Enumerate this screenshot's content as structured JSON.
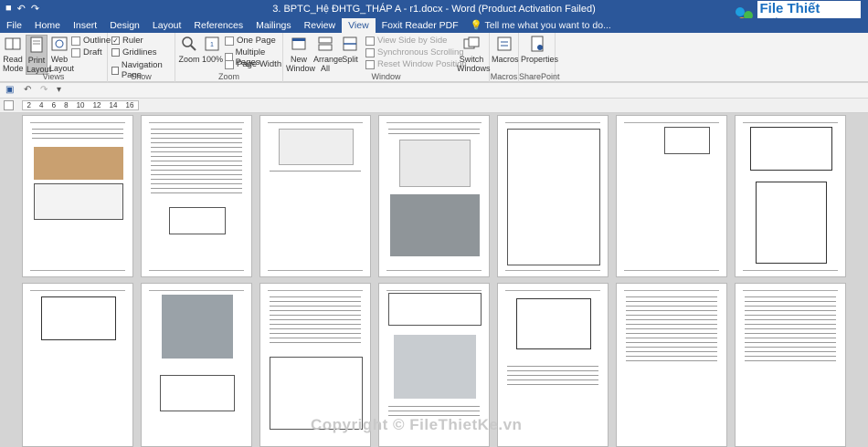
{
  "window": {
    "title": "3. BPTC_Hệ ĐHTG_THÁP A - r1.docx - Word (Product Activation Failed)"
  },
  "tabs": [
    {
      "label": "File"
    },
    {
      "label": "Home"
    },
    {
      "label": "Insert"
    },
    {
      "label": "Design"
    },
    {
      "label": "Layout"
    },
    {
      "label": "References"
    },
    {
      "label": "Mailings"
    },
    {
      "label": "Review"
    },
    {
      "label": "View"
    },
    {
      "label": "Foxit Reader PDF"
    }
  ],
  "tellme": "Tell me what you want to do...",
  "ribbon": {
    "views": {
      "label": "Views",
      "read_mode": "Read Mode",
      "print_layout": "Print Layout",
      "web_layout": "Web Layout",
      "outline": "Outline",
      "draft": "Draft"
    },
    "show": {
      "label": "Show",
      "ruler": "Ruler",
      "gridlines": "Gridlines",
      "navigation_pane": "Navigation Pane"
    },
    "zoom": {
      "label": "Zoom",
      "zoom": "Zoom",
      "hundred": "100%",
      "one_page": "One Page",
      "multiple_pages": "Multiple Pages",
      "page_width": "Page Width"
    },
    "window": {
      "label": "Window",
      "new_window": "New Window",
      "arrange_all": "Arrange All",
      "split": "Split",
      "view_side_by_side": "View Side by Side",
      "synchronous_scrolling": "Synchronous Scrolling",
      "reset_window_position": "Reset Window Position",
      "switch_windows": "Switch Windows"
    },
    "macros": {
      "label": "Macros",
      "macros": "Macros"
    },
    "sharepoint": {
      "label": "SharePoint",
      "properties": "Properties"
    }
  },
  "ruler": {
    "marks": [
      "2",
      "4",
      "6",
      "8",
      "10",
      "12",
      "14",
      "16"
    ]
  },
  "watermark": "Copyright © FileThietKe.vn",
  "logo_text": "File Thiết Kế.vn",
  "colors": {
    "accent": "#2b579a"
  }
}
